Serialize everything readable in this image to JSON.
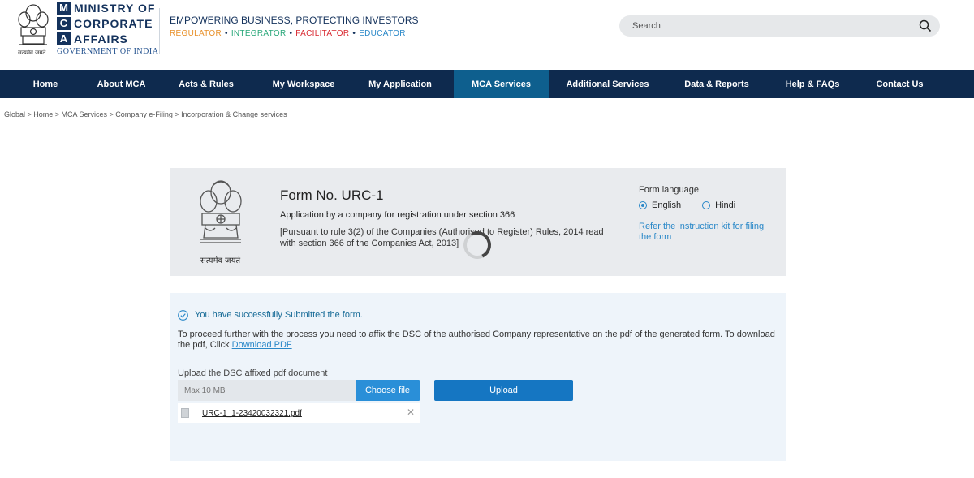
{
  "header": {
    "emblem_caption": "सत्यमेव जयते",
    "mca_letters": [
      "M",
      "C",
      "A"
    ],
    "mca_words": [
      "MINISTRY OF",
      "CORPORATE",
      "AFFAIRS"
    ],
    "government": "GOVERNMENT OF INDIA",
    "tagline": "EMPOWERING BUSINESS, PROTECTING INVESTORS",
    "roles": [
      {
        "label": "REGULATOR",
        "color": "#e8912b"
      },
      {
        "label": "INTEGRATOR",
        "color": "#2aa87a"
      },
      {
        "label": "FACILITATOR",
        "color": "#d8262e"
      },
      {
        "label": "EDUCATOR",
        "color": "#2a88c8"
      }
    ],
    "search_placeholder": "Search"
  },
  "nav": {
    "items": [
      "Home",
      "About MCA",
      "Acts & Rules",
      "My Workspace",
      "My Application",
      "MCA Services",
      "Additional Services",
      "Data & Reports",
      "Help & FAQs",
      "Contact Us"
    ],
    "active": "MCA Services"
  },
  "breadcrumb": "Global > Home > MCA Services > Company e-Filing > Incorporation & Change services",
  "form": {
    "emblem_caption": "सत्यमेव जयते",
    "title": "Form No. URC-1",
    "subtitle": "Application by a company for registration under section 366",
    "rule": "[Pursuant to rule 3(2) of the Companies (Authorised to Register) Rules, 2014 read with section 366 of the Companies Act, 2013]",
    "language_label": "Form language",
    "languages": [
      "English",
      "Hindi"
    ],
    "selected_language": "English",
    "instruction_link": "Refer the instruction kit for filing the form"
  },
  "status": {
    "success": "You have successfully Submitted the form.",
    "instruction": "To proceed further with the process you need to affix the DSC of the authorised Company representative on the pdf of the generated form. To download the pdf, Click ",
    "download_link": "Download PDF",
    "upload_label": "Upload the DSC affixed pdf document",
    "file_placeholder": "Max 10 MB",
    "choose_button": "Choose file",
    "upload_button": "Upload",
    "uploaded_file": "URC-1_1-23420032321.pdf"
  }
}
